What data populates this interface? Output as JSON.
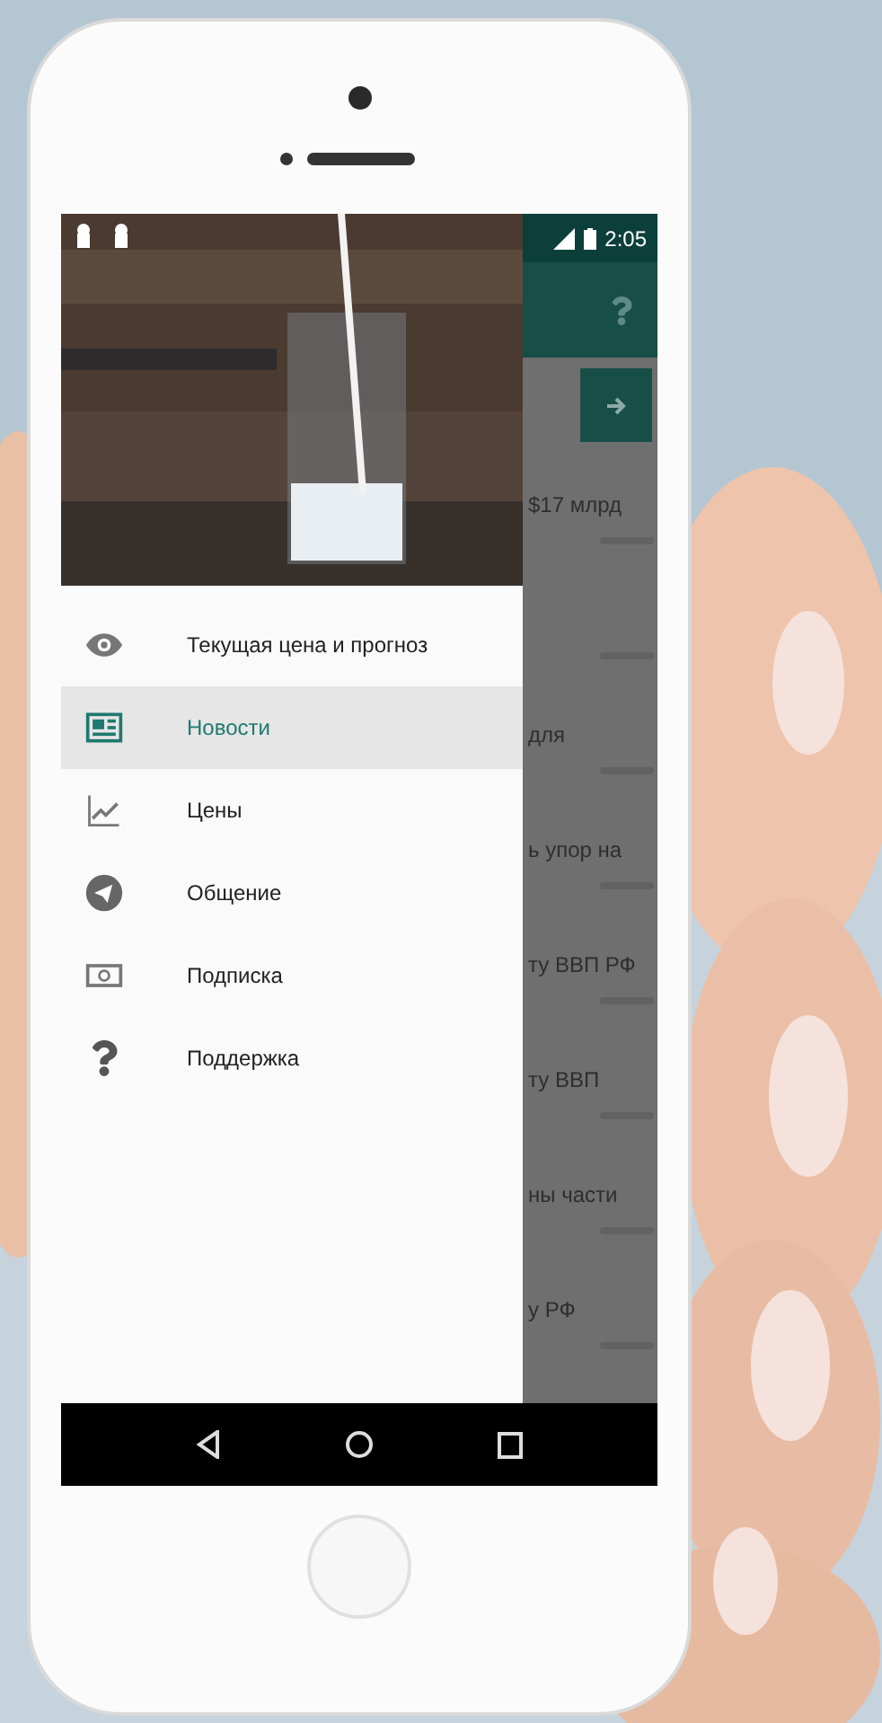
{
  "status_bar": {
    "time": "2:05"
  },
  "drawer": {
    "items": [
      {
        "kind": "eye",
        "label": "Текущая цена и прогноз",
        "selected": false
      },
      {
        "kind": "news",
        "label": "Новости",
        "selected": true
      },
      {
        "kind": "chart",
        "label": "Цены",
        "selected": false
      },
      {
        "kind": "send",
        "label": "Общение",
        "selected": false
      },
      {
        "kind": "money",
        "label": "Подписка",
        "selected": false
      },
      {
        "kind": "help",
        "label": "Поддержка",
        "selected": false
      }
    ]
  },
  "feed": {
    "rows": [
      {
        "headline": "$17 млрд"
      },
      {},
      {
        "headline": "для"
      },
      {
        "headline": "ь упор на"
      },
      {
        "headline": "ту ВВП РФ"
      },
      {
        "headline": "ту ВВП"
      },
      {
        "headline": "ны части"
      },
      {
        "headline": "у РФ"
      }
    ]
  }
}
